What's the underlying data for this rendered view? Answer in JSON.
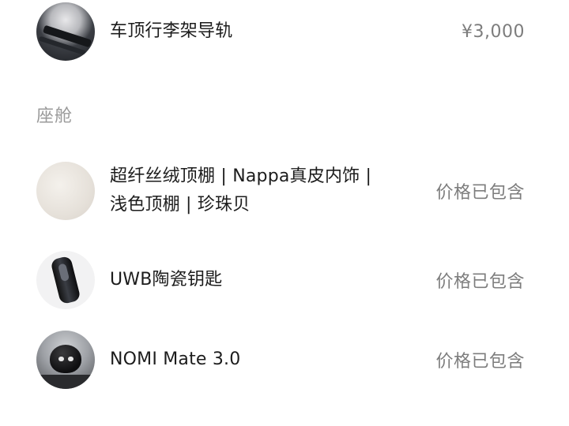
{
  "items_top": [
    {
      "name": "车顶行李架导轨",
      "price": "¥3,000",
      "icon": "roof-rail-thumbnail"
    }
  ],
  "section": {
    "title": "座舱"
  },
  "cabin_items": [
    {
      "name": "超纤丝绒顶棚 | Nappa真皮内饰 | 浅色顶棚 | 珍珠贝",
      "price": "价格已包含",
      "icon": "headliner-thumbnail"
    },
    {
      "name": "UWB陶瓷钥匙",
      "price": "价格已包含",
      "icon": "key-thumbnail"
    },
    {
      "name": "NOMI Mate 3.0",
      "price": "价格已包含",
      "icon": "nomi-thumbnail"
    }
  ],
  "colors": {
    "text_primary": "#1c1c1c",
    "text_secondary": "#7d7d7d",
    "section_title": "#9a9a9a",
    "background": "#ffffff"
  }
}
